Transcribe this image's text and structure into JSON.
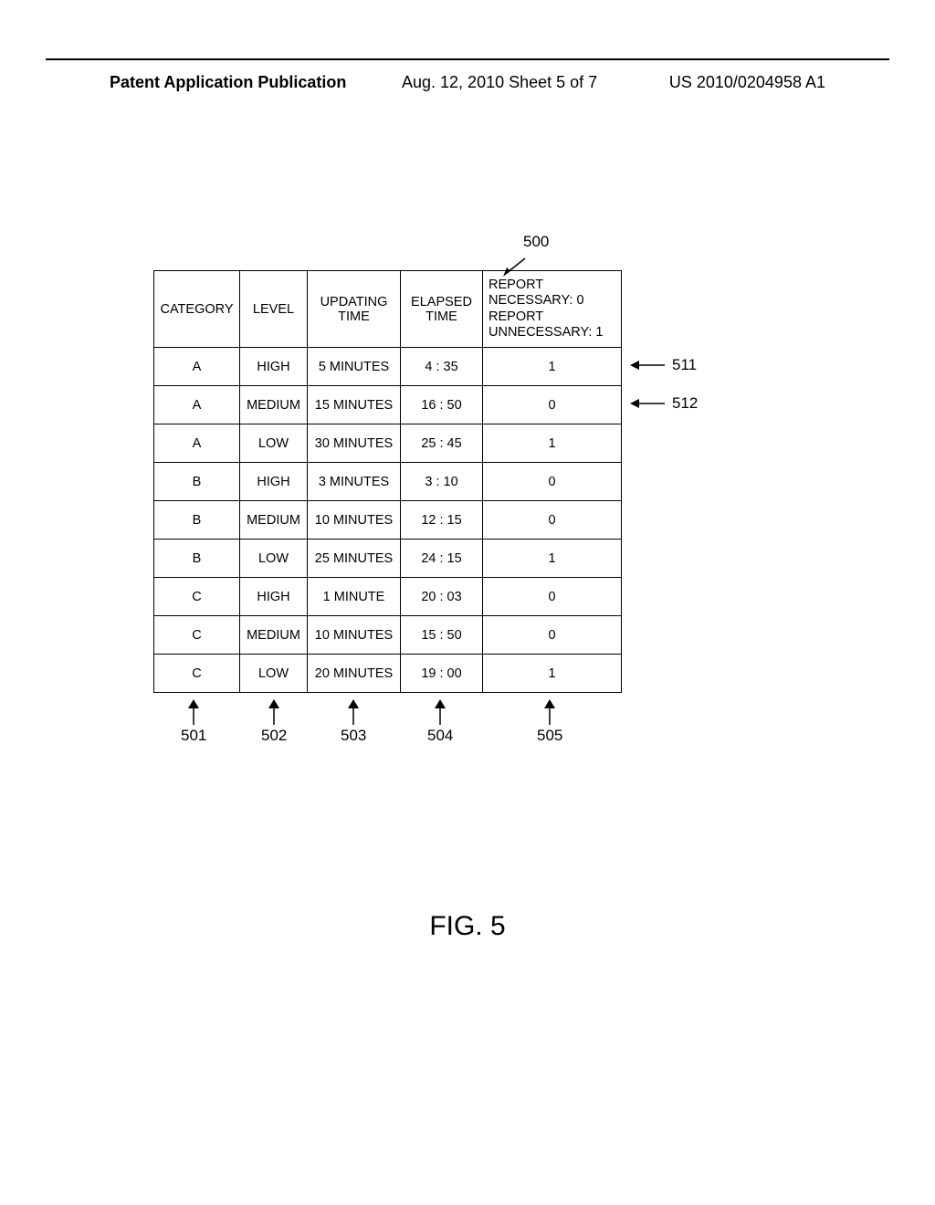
{
  "header": {
    "left": "Patent Application Publication",
    "mid": "Aug. 12, 2010  Sheet 5 of 7",
    "right": "US 2010/0204958 A1"
  },
  "figure": {
    "label": "FIG. 5",
    "ref": "500"
  },
  "row_refs": {
    "r1": "511",
    "r2": "512"
  },
  "col_refs": {
    "c1": "501",
    "c2": "502",
    "c3": "503",
    "c4": "504",
    "c5": "505"
  },
  "table": {
    "headers": {
      "category": "CATEGORY",
      "level": "LEVEL",
      "updating_time": "UPDATING TIME",
      "elapsed_time": "ELAPSED TIME",
      "report": "REPORT\nNECESSARY: 0\nREPORT\nUNNECESSARY: 1"
    },
    "rows": [
      {
        "category": "A",
        "level": "HIGH",
        "updating": "5 MINUTES",
        "elapsed": "4 : 35",
        "report": "1"
      },
      {
        "category": "A",
        "level": "MEDIUM",
        "updating": "15 MINUTES",
        "elapsed": "16 : 50",
        "report": "0"
      },
      {
        "category": "A",
        "level": "LOW",
        "updating": "30 MINUTES",
        "elapsed": "25 : 45",
        "report": "1"
      },
      {
        "category": "B",
        "level": "HIGH",
        "updating": "3 MINUTES",
        "elapsed": "3 : 10",
        "report": "0"
      },
      {
        "category": "B",
        "level": "MEDIUM",
        "updating": "10 MINUTES",
        "elapsed": "12 : 15",
        "report": "0"
      },
      {
        "category": "B",
        "level": "LOW",
        "updating": "25 MINUTES",
        "elapsed": "24 : 15",
        "report": "1"
      },
      {
        "category": "C",
        "level": "HIGH",
        "updating": "1 MINUTE",
        "elapsed": "20 : 03",
        "report": "0"
      },
      {
        "category": "C",
        "level": "MEDIUM",
        "updating": "10 MINUTES",
        "elapsed": "15 : 50",
        "report": "0"
      },
      {
        "category": "C",
        "level": "LOW",
        "updating": "20 MINUTES",
        "elapsed": "19 : 00",
        "report": "1"
      }
    ]
  }
}
